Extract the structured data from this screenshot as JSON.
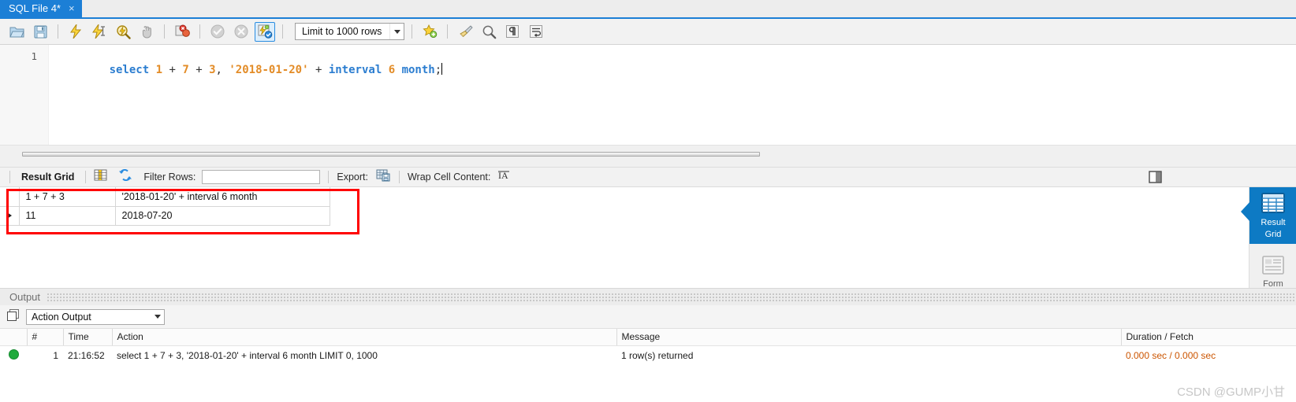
{
  "tab": {
    "label": "SQL File 4*",
    "close": "×"
  },
  "toolbar": {
    "icons": [
      {
        "name": "open-file-icon",
        "title": "Open SQL Script File"
      },
      {
        "name": "save-file-icon",
        "title": "Save Script to File"
      },
      {
        "name": "execute-icon",
        "title": "Execute Statement"
      },
      {
        "name": "execute-current-icon",
        "title": "Execute Current Statement"
      },
      {
        "name": "explain-icon",
        "title": "Explain Current Statement"
      },
      {
        "name": "stop-icon",
        "title": "Stop Statement"
      },
      {
        "name": "toggle-stop-on-error-icon",
        "title": "Toggle whether execution should stop on errors"
      },
      {
        "name": "commit-icon",
        "title": "Commit"
      },
      {
        "name": "rollback-icon",
        "title": "Rollback"
      },
      {
        "name": "autocommit-icon",
        "title": "Toggle Auto-Commit Mode"
      },
      {
        "name": "beautify-icon",
        "title": "Beautify SQL"
      },
      {
        "name": "find-icon",
        "title": "Find"
      },
      {
        "name": "invisible-chars-icon",
        "title": "Toggle invisible characters"
      },
      {
        "name": "wrap-lines-icon",
        "title": "Toggle wrapping of long lines"
      }
    ],
    "limit_label": "Limit to 1000 rows",
    "star_icon": "add-snippet-icon"
  },
  "editor": {
    "line_number": "1",
    "tokens": [
      {
        "t": "select",
        "c": "k"
      },
      {
        "t": " ",
        "c": "p"
      },
      {
        "t": "1",
        "c": "n"
      },
      {
        "t": " + ",
        "c": "p"
      },
      {
        "t": "7",
        "c": "n"
      },
      {
        "t": " + ",
        "c": "p"
      },
      {
        "t": "3",
        "c": "n"
      },
      {
        "t": ", ",
        "c": "p"
      },
      {
        "t": "'2018-01-20'",
        "c": "s"
      },
      {
        "t": " + ",
        "c": "p"
      },
      {
        "t": "interval",
        "c": "k"
      },
      {
        "t": " ",
        "c": "p"
      },
      {
        "t": "6",
        "c": "n"
      },
      {
        "t": " ",
        "c": "p"
      },
      {
        "t": "month",
        "c": "k"
      },
      {
        "t": ";",
        "c": "p"
      }
    ],
    "full_text": "select 1 + 7 + 3, '2018-01-20' + interval 6 month;"
  },
  "result_toolbar": {
    "title": "Result Grid",
    "grid_icon": "field-types-icon",
    "refresh_icon": "refresh-icon",
    "filter_label": "Filter Rows:",
    "filter_value": "",
    "filter_placeholder": "",
    "export_label": "Export:",
    "export_icon": "export-icon",
    "wrap_label": "Wrap Cell Content:",
    "wrap_icon": "wrap-cell-icon",
    "panel_toggle_icon": "toggle-sidebar-icon"
  },
  "result_grid": {
    "columns": [
      "1 + 7 + 3",
      "'2018-01-20' + interval 6 month"
    ],
    "rows": [
      {
        "marker": "▶",
        "cells": [
          "11",
          "2018-07-20"
        ]
      }
    ]
  },
  "side_panel": {
    "items": [
      {
        "label_line1": "Result",
        "label_line2": "Grid",
        "icon": "result-grid-icon",
        "selected": true
      },
      {
        "label_line1": "Form",
        "label_line2": "",
        "icon": "form-editor-icon",
        "selected": false
      }
    ]
  },
  "output": {
    "section_title": "Output",
    "mode_icon": "output-panel-icon",
    "mode_value": "Action Output",
    "columns": [
      "#",
      "Time",
      "Action",
      "Message",
      "Duration / Fetch"
    ],
    "rows": [
      {
        "status_icon": "success-icon",
        "num": "1",
        "time": "21:16:52",
        "action": "select 1 + 7 + 3, '2018-01-20' + interval 6 month LIMIT 0, 1000",
        "message": "1 row(s) returned",
        "duration": "0.000 sec / 0.000 sec"
      }
    ]
  },
  "watermark": "CSDN @GUMP小甘",
  "colors": {
    "accent": "#1c7fd6",
    "panel_selected": "#0d7ac4",
    "annotation": "#ff0000",
    "keyword": "#2b7dd0",
    "literal": "#e38c27",
    "success": "#1faa3c",
    "duration": "#cc5500"
  }
}
